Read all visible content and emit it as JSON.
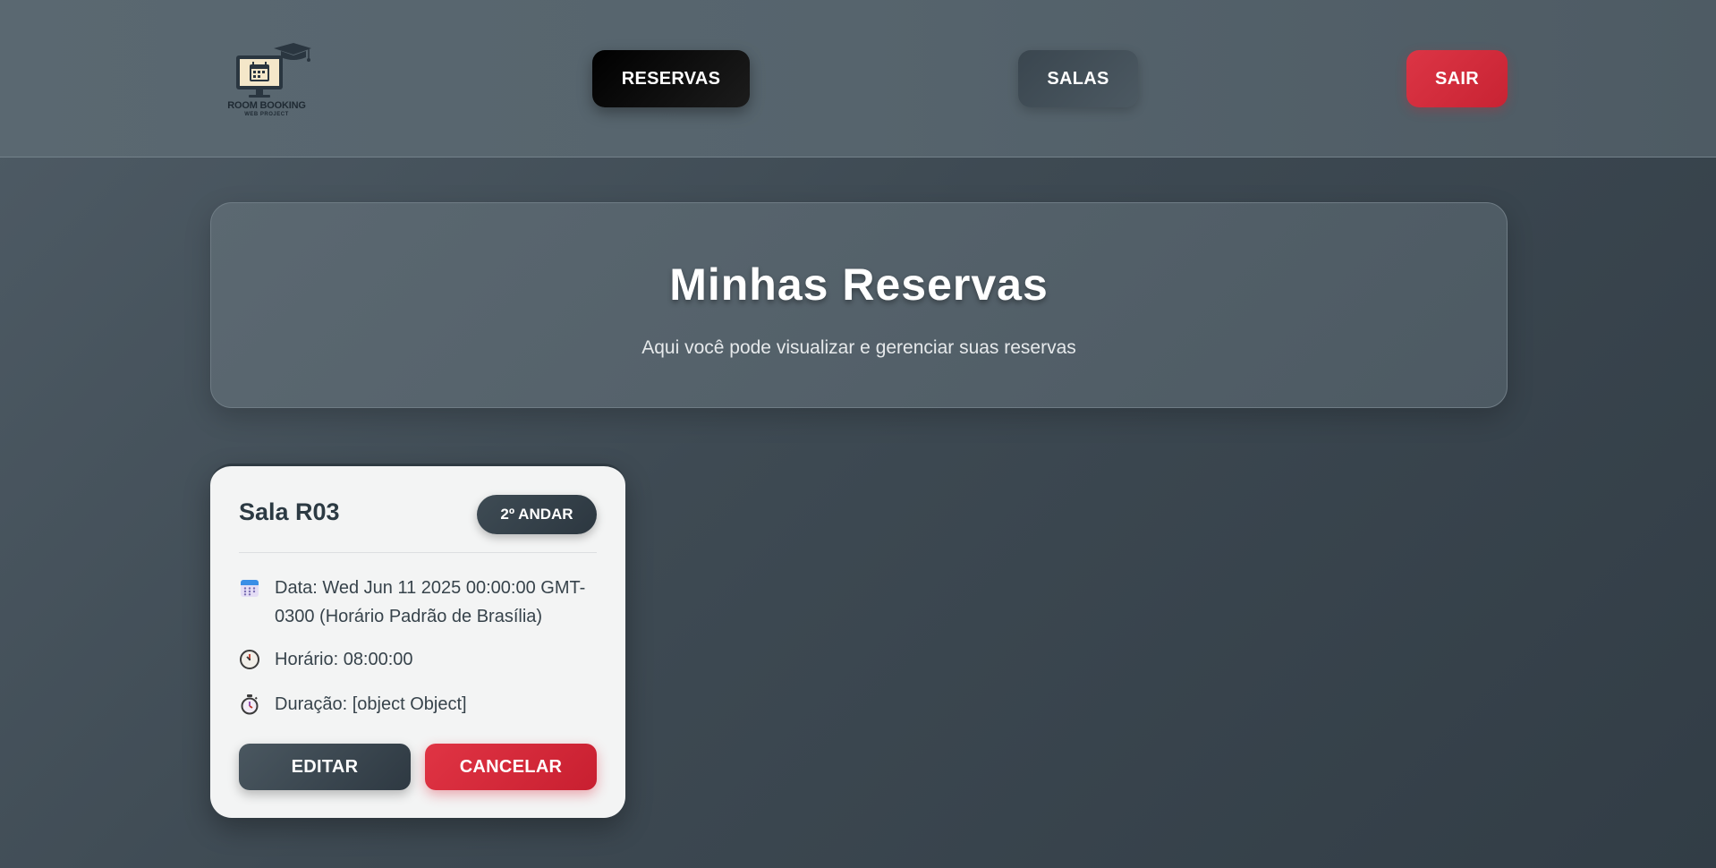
{
  "header": {
    "logo": {
      "title": "ROOM BOOKING",
      "subtitle": "WEB PROJECT",
      "icon": "monitor-calendar-graduation-cap-icon"
    },
    "nav": {
      "reservas": "RESERVAS",
      "salas": "SALAS",
      "sair": "SAIR"
    }
  },
  "hero": {
    "title": "Minhas Reservas",
    "subtitle": "Aqui você pode visualizar e gerenciar suas reservas"
  },
  "reservations": [
    {
      "room": "Sala R03",
      "floor": "2º ANDAR",
      "date": "Data: Wed Jun 11 2025 00:00:00 GMT-0300 (Horário Padrão de Brasília)",
      "time": "Horário: 08:00:00",
      "duration": "Duração: [object Object]",
      "icons": {
        "date": "calendar-icon",
        "time": "clock-icon",
        "duration": "stopwatch-icon"
      },
      "actions": {
        "edit": "EDITAR",
        "cancel": "CANCELAR"
      }
    }
  ],
  "colors": {
    "accent_dark": "#2c3740",
    "danger": "#dc3545",
    "active_nav": "#000000"
  }
}
